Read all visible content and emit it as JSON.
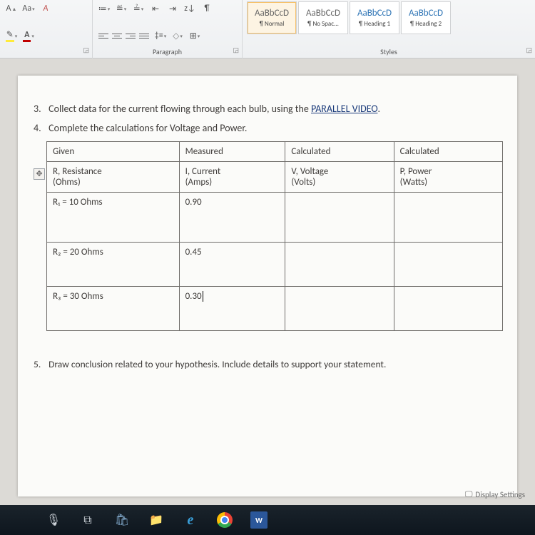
{
  "ribbon": {
    "font_group_label": "",
    "paragraph_group_label": "Paragraph",
    "styles_group_label": "Styles",
    "change_case": "Aa",
    "sort": "z↓",
    "pilcrow": "¶",
    "styles": [
      {
        "sample": "AaBbCcD",
        "name": "¶ Normal"
      },
      {
        "sample": "AaBbCcD",
        "name": "¶ No Spac..."
      },
      {
        "sample": "AaBbCcD",
        "name": "¶ Heading 1"
      },
      {
        "sample": "AaBbCcD",
        "name": "¶ Heading 2"
      }
    ]
  },
  "document": {
    "q3_num": "3.",
    "q3_text_a": "Collect data for the current flowing through each bulb, using the ",
    "q3_link": "PARALLEL VIDEO",
    "q3_text_b": ".",
    "q4_num": "4.",
    "q4_text": "Complete the calculations for Voltage and Power.",
    "q5_num": "5.",
    "q5_text": "Draw conclusion related to your hypothesis. Include details to support your statement.",
    "headers": {
      "c1": "Given",
      "c2": "Measured",
      "c3": "Calculated",
      "c4": "Calculated"
    },
    "units": {
      "c1a": "R, Resistance",
      "c2a": "I, Current",
      "c3a": "V, Voltage",
      "c4a": "P, Power",
      "c1b": "(Ohms)",
      "c2b": "(Amps)",
      "c3b": "(Volts)",
      "c4b": "(Watts)"
    },
    "rows": [
      {
        "given": "R₁ = 10 Ohms",
        "measured": "0.90",
        "calc_v": "",
        "calc_p": ""
      },
      {
        "given": "R₂ = 20 Ohms",
        "measured": "0.45",
        "calc_v": "",
        "calc_p": ""
      },
      {
        "given": "R₃ = 30 Ohms",
        "measured": "0.30",
        "calc_v": "",
        "calc_p": ""
      }
    ]
  },
  "status": {
    "display_settings": "Display Settings"
  },
  "taskbar": {
    "word": "W"
  },
  "chart_data": {
    "type": "table",
    "title": "Parallel circuit bulb data",
    "columns": [
      "R, Resistance (Ohms)",
      "I, Current (Amps)",
      "V, Voltage (Volts)",
      "P, Power (Watts)"
    ],
    "rows": [
      {
        "resistance_ohms": 10,
        "current_amps": 0.9,
        "voltage_volts": null,
        "power_watts": null
      },
      {
        "resistance_ohms": 20,
        "current_amps": 0.45,
        "voltage_volts": null,
        "power_watts": null
      },
      {
        "resistance_ohms": 30,
        "current_amps": 0.3,
        "voltage_volts": null,
        "power_watts": null
      }
    ]
  }
}
